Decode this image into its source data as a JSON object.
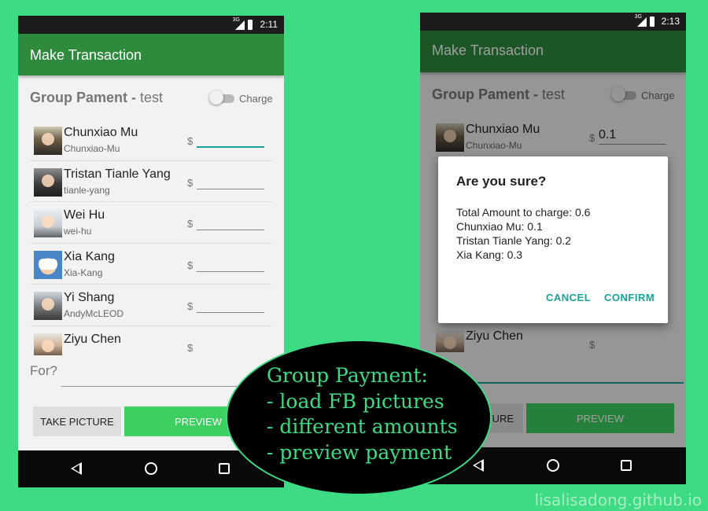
{
  "left_phone": {
    "status": {
      "network": "3G",
      "time": "2:11"
    },
    "app_title": "Make Transaction",
    "group": {
      "label": "Group Pament - ",
      "name": "test"
    },
    "charge_label": "Charge",
    "friends": [
      {
        "name": "Chunxiao Mu",
        "handle": "Chunxiao-Mu",
        "amount": "",
        "avatar": "avatar-photo"
      },
      {
        "name": "Tristan Tianle Yang",
        "handle": "tianle-yang",
        "amount": "",
        "avatar": "avatar-photo"
      },
      {
        "name": "Wei Hu",
        "handle": "wei-hu",
        "amount": "",
        "avatar": "avatar-photo"
      },
      {
        "name": "Xia Kang",
        "handle": "Xia-Kang",
        "amount": "",
        "avatar": "avatar-cartoon"
      },
      {
        "name": "Yi Shang",
        "handle": "AndyMcLEOD",
        "amount": "",
        "avatar": "avatar-photo"
      },
      {
        "name": "Ziyu Chen",
        "handle": "",
        "amount": "",
        "avatar": "avatar-photo"
      }
    ],
    "currency_symbol": "$",
    "for_label": "For?",
    "for_value": "",
    "buttons": {
      "take_picture": "TAKE PICTURE",
      "preview": "PREVIEW"
    }
  },
  "right_phone": {
    "status": {
      "network": "3G",
      "time": "2:13"
    },
    "app_title": "Make Transaction",
    "group": {
      "label": "Group Pament - ",
      "name": "test"
    },
    "charge_label": "Charge",
    "friends": [
      {
        "name": "Chunxiao Mu",
        "handle": "Chunxiao-Mu",
        "amount": "0.1"
      },
      {
        "name": "Ziyu Chen",
        "handle": "",
        "amount": ""
      }
    ],
    "currency_symbol": "$",
    "buttons": {
      "take_picture_partial": "TURE",
      "preview": "PREVIEW"
    },
    "dialog": {
      "title": "Are you sure?",
      "lines": [
        "Total Amount to charge: 0.6",
        "Chunxiao Mu: 0.1",
        "Tristan Tianle Yang: 0.2",
        "Xia Kang: 0.3"
      ],
      "cancel": "CANCEL",
      "confirm": "CONFIRM"
    }
  },
  "annotation": {
    "lines": [
      "Group Payment:",
      "- load FB pictures",
      "- different amounts",
      "- preview payment"
    ]
  },
  "watermark": "lisalisadong.github.io",
  "colors": {
    "background": "#3ddc84",
    "app_bar": "#2e8b3e",
    "preview_button": "#3dcf5f",
    "dialog_accent": "#16a39a",
    "annotation_text": "#3ddc84"
  }
}
